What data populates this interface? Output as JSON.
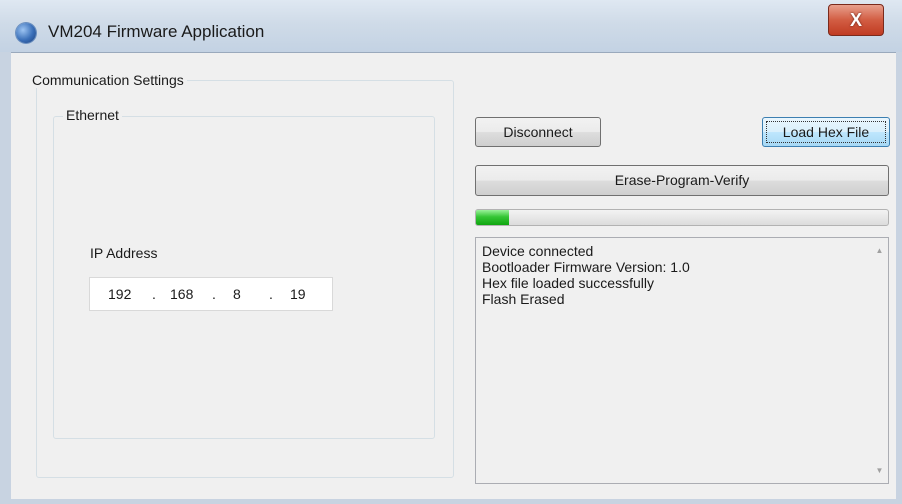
{
  "window": {
    "title": "VM204 Firmware Application",
    "close_glyph": "X",
    "icon": "app-globe-icon"
  },
  "communication": {
    "group_label": "Communication Settings",
    "ethernet_label": "Ethernet",
    "ip_label": "IP Address",
    "ip": [
      "192",
      "168",
      "8",
      "19"
    ],
    "ip_separator": "."
  },
  "actions": {
    "disconnect_label": "Disconnect",
    "load_hex_label": "Load Hex File",
    "erase_program_verify_label": "Erase-Program-Verify"
  },
  "progress": {
    "value": 0.08,
    "color": "#22b822"
  },
  "log": {
    "lines": [
      "Device connected",
      "Bootloader Firmware Version: 1.0",
      "Hex file loaded successfully",
      "Flash Erased"
    ],
    "scroll_up_glyph": "▲",
    "scroll_down_glyph": "▼"
  }
}
